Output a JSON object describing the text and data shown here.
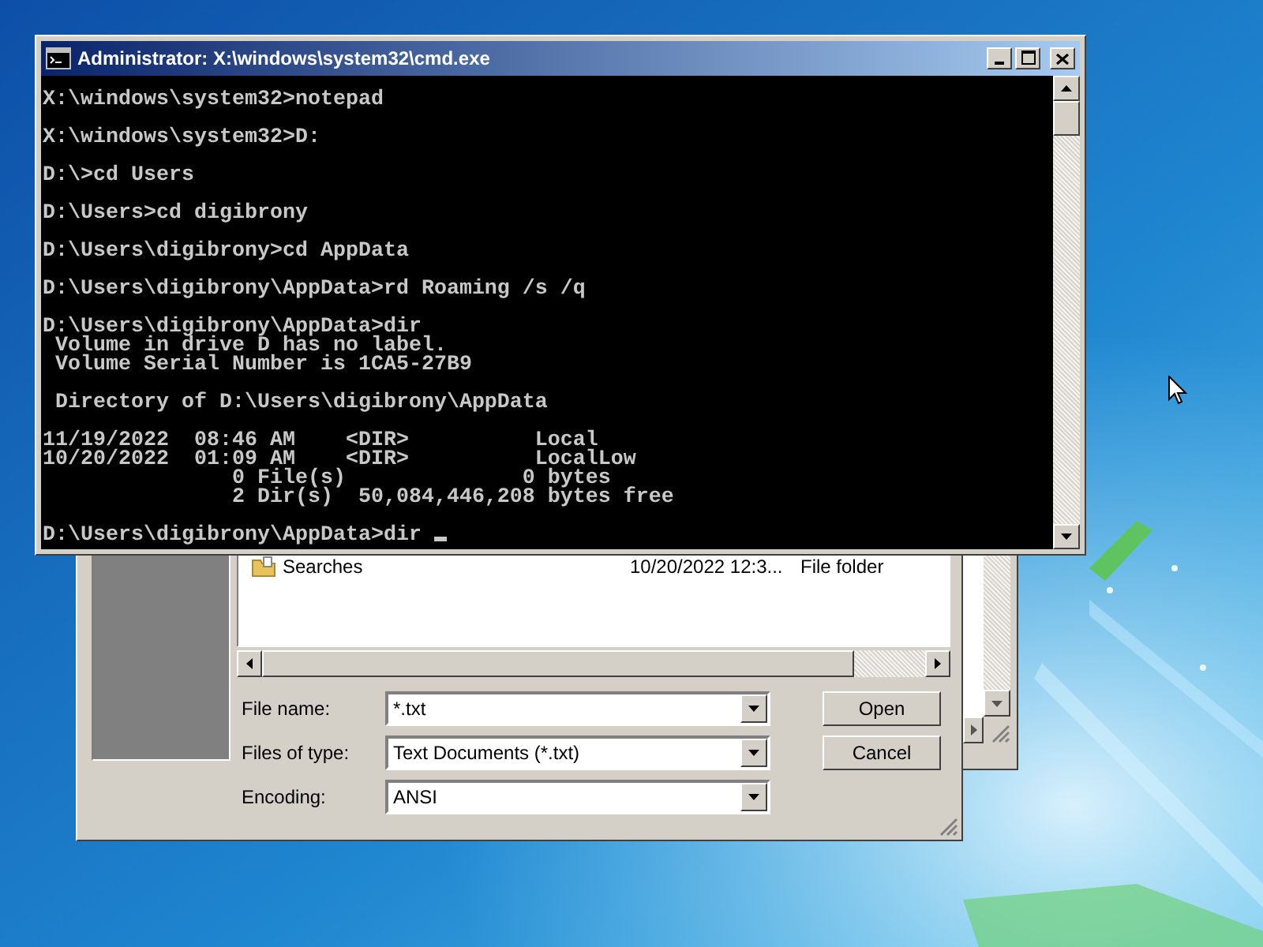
{
  "console_window": {
    "title": "Administrator: X:\\windows\\system32\\cmd.exe",
    "blocks": [
      [
        "X:\\windows\\system32>notepad"
      ],
      [
        "X:\\windows\\system32>D:"
      ],
      [
        "D:\\>cd Users"
      ],
      [
        "D:\\Users>cd digibrony"
      ],
      [
        "D:\\Users\\digibrony>cd AppData"
      ],
      [
        "D:\\Users\\digibrony\\AppData>rd Roaming /s /q"
      ],
      [
        "D:\\Users\\digibrony\\AppData>dir",
        " Volume in drive D has no label.",
        " Volume Serial Number is 1CA5-27B9"
      ],
      [
        " Directory of D:\\Users\\digibrony\\AppData"
      ],
      [
        "11/19/2022  08:46 AM    <DIR>          Local",
        "10/20/2022  01:09 AM    <DIR>          LocalLow",
        "               0 File(s)              0 bytes",
        "               2 Dir(s)  50,084,446,208 bytes free"
      ],
      [
        "D:\\Users\\digibrony\\AppData>dir "
      ]
    ]
  },
  "open_dialog": {
    "files": [
      {
        "name": "Searches",
        "modified": "10/20/2022 12:3...",
        "type": "File folder"
      }
    ],
    "fields": [
      {
        "label": "File name:",
        "value": "*.txt"
      },
      {
        "label": "Files of type:",
        "value": "Text Documents (*.txt)"
      },
      {
        "label": "Encoding:",
        "value": "ANSI"
      }
    ],
    "buttons": [
      "Open",
      "Cancel"
    ]
  }
}
